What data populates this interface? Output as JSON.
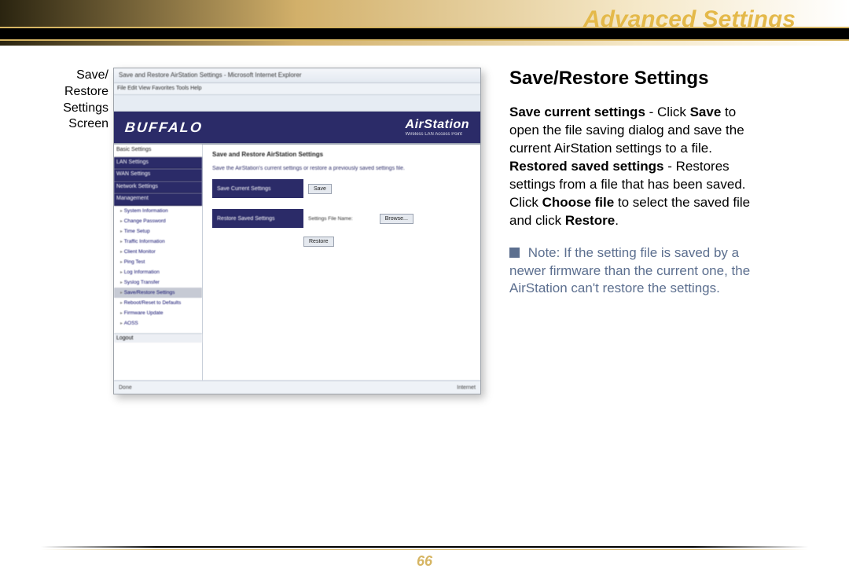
{
  "header": {
    "title": "Advanced Settings"
  },
  "caption": {
    "line1": "Save/",
    "line2": "Restore",
    "line3": "Settings",
    "line4": "Screen"
  },
  "screenshot": {
    "window_title": "Save and Restore AirStation Settings - Microsoft Internet Explorer",
    "menu_bar": "File   Edit   View   Favorites   Tools   Help",
    "brand_left": "BUFFALO",
    "brand_right": "AirStation",
    "brand_sub": "Wireless LAN Access Point",
    "sidebar_top": "Basic Settings",
    "sidebar_groups": [
      "LAN Settings",
      "WAN Settings",
      "Network Settings",
      "Management"
    ],
    "sidebar_items": [
      "System Information",
      "Change Password",
      "Time Setup",
      "Traffic Information",
      "Client Monitor",
      "Ping Test",
      "Log Information",
      "Syslog Transfer",
      "Save/Restore Settings",
      "Reboot/Reset to Defaults",
      "Firmware Update",
      "AOSS"
    ],
    "sidebar_logout": "Logout",
    "pane_title": "Save and Restore AirStation Settings",
    "pane_desc": "Save the AirStation's current settings or restore a previously saved settings file.",
    "row1_label": "Save Current Settings",
    "row1_button": "Save",
    "row2_label": "Restore Saved Settings",
    "row2_file_note": "Settings File Name:",
    "row2_browse": "Browse...",
    "row2_restore": "Restore",
    "status_left": "Done",
    "status_right": "Internet"
  },
  "rightcol": {
    "heading": "Save/Restore Settings",
    "p1_b1": "Save current settings",
    "p1_t1": " - Click ",
    "p1_b2": "Save",
    "p1_t2": " to open the file saving dialog and save the current AirStation settings to a file.",
    "p2_b1": "Restored saved settings",
    "p2_t1": " - Restores settings from a file that has been saved. Click ",
    "p2_b2": "Choose file",
    "p2_t2": " to select the saved file and click ",
    "p2_b3": "Restore",
    "p2_t3": ".",
    "note_label": " Note: ",
    "note_text": "If the setting file is saved by a newer firmware than the current one, the AirStation can't restore the settings."
  },
  "footer": {
    "page_number": "66"
  }
}
